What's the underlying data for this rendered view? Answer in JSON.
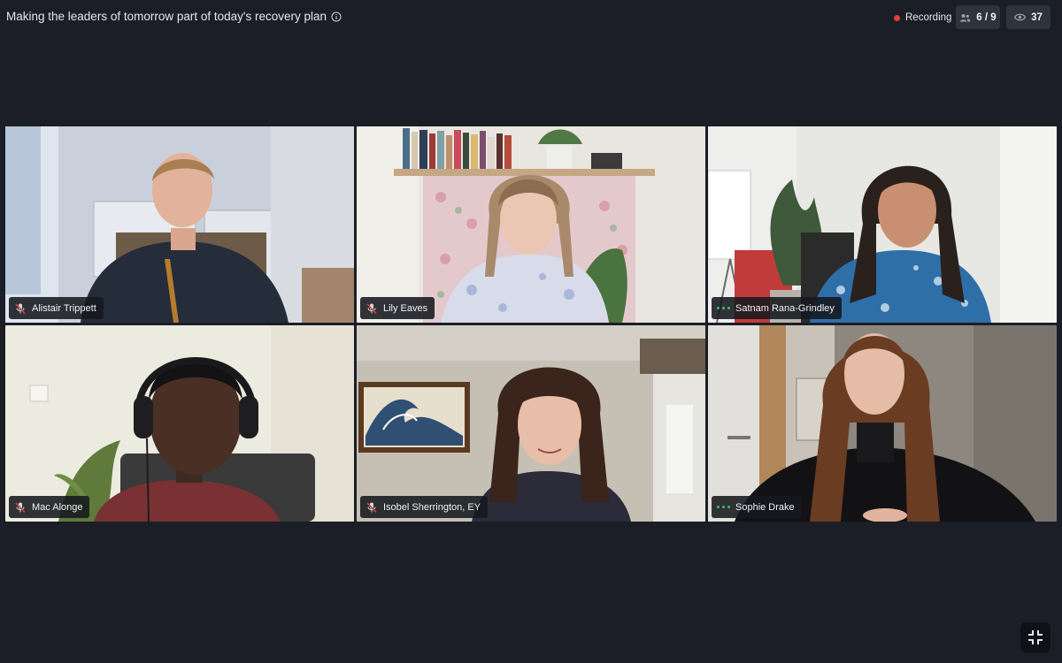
{
  "header": {
    "title": "Making the leaders of tomorrow part of today's recovery plan",
    "info_icon": "info-circle-icon",
    "recording_label": "Recording",
    "recording_color": "#e53e3e",
    "participants_count": "6 / 9",
    "viewers_count": "37"
  },
  "participants": [
    {
      "name": "Alistair Trippett",
      "status": "muted"
    },
    {
      "name": "Lily Eaves",
      "status": "muted"
    },
    {
      "name": "Satnam Rana-Grindley",
      "status": "speaking"
    },
    {
      "name": "Mac Alonge",
      "status": "muted"
    },
    {
      "name": "Isobel Sherrington, EY",
      "status": "muted"
    },
    {
      "name": "Sophie Drake",
      "status": "speaking"
    }
  ],
  "controls": {
    "exit_fullscreen_icon": "exit-fullscreen-icon"
  },
  "colors": {
    "background": "#1b1e27",
    "pill": "#2f333d",
    "speaking": "#34c759"
  }
}
